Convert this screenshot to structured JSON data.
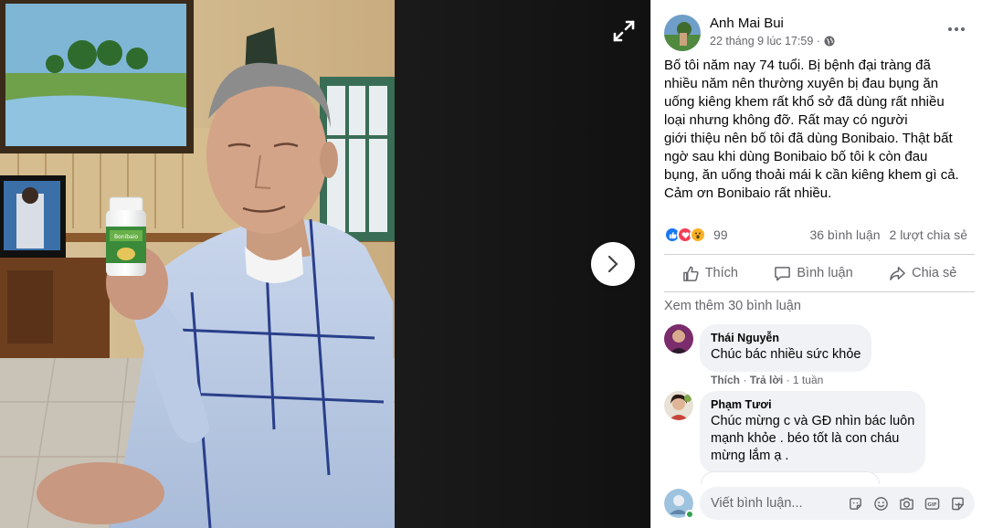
{
  "viewer": {
    "expand_icon": "expand-icon",
    "next_icon": "chevron-right-icon",
    "bottle_label": "Bonibaio"
  },
  "post": {
    "author": "Anh Mai Bui",
    "date": "22 tháng 9 lúc 17:59 ·",
    "privacy_icon": "globe-icon",
    "body": "Bố tôi năm nay 74 tuổi. Bị bệnh đại tràng đã\nnhiều năm nên thường xuyên bị đau bụng ăn\nuống kiêng khem rất khổ sở đã dùng rất nhiều\nloại  nhưng không đỡ. Rất may có người\ngiới thiệu nên bố tôi đã dùng Bonibaio. Thật bất\nngờ sau khi dùng Bonibaio bố tôi k còn đau\nbụng, ăn uống thoải mái k cần kiêng khem gì cả.\nCảm ơn Bonibaio rất nhiều.",
    "reaction_count": "99",
    "comments_count": "36 bình luận",
    "shares_count": "2 lượt chia sẻ",
    "colors": {
      "like": "#1877f2",
      "love": "#f33e58",
      "wow": "#f7b125",
      "online": "#31a24c"
    }
  },
  "actions": {
    "like": "Thích",
    "comment": "Bình luận",
    "share": "Chia sẻ"
  },
  "see_more": "Xem thêm 30 bình luận",
  "comments": [
    {
      "name": "Thái Nguyễn",
      "text": "Chúc bác nhiều sức khỏe",
      "like": "Thích",
      "reply": "Trả lời",
      "time": "1 tuần"
    },
    {
      "name": "Phạm Tươi",
      "text": "Chúc mừng c và GĐ nhìn bác luôn\nmạnh khỏe . béo tốt là con cháu\nmừng lắm ạ ."
    }
  ],
  "composer": {
    "placeholder": "Viết bình luận...",
    "tools": [
      "sticker-icon",
      "emoji-icon",
      "camera-icon",
      "gif-icon",
      "sticker-pack-icon"
    ]
  }
}
